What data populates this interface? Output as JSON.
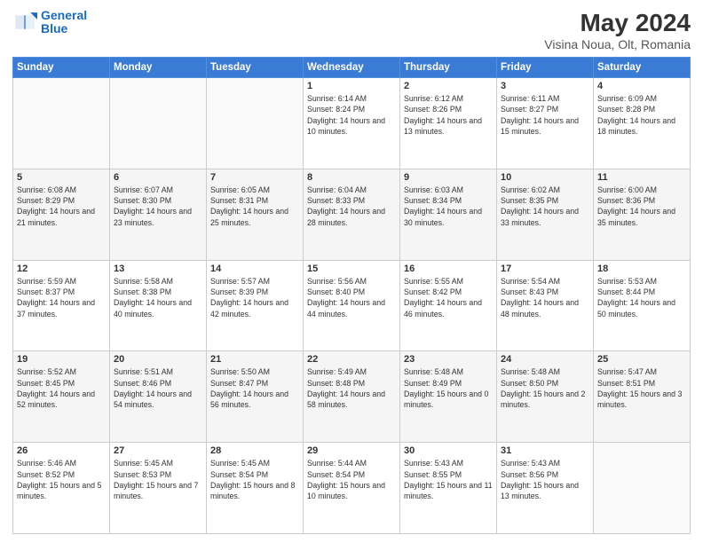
{
  "header": {
    "logo_line1": "General",
    "logo_line2": "Blue",
    "main_title": "May 2024",
    "sub_title": "Visina Noua, Olt, Romania"
  },
  "weekdays": [
    "Sunday",
    "Monday",
    "Tuesday",
    "Wednesday",
    "Thursday",
    "Friday",
    "Saturday"
  ],
  "weeks": [
    [
      {
        "day": "",
        "empty": true
      },
      {
        "day": "",
        "empty": true
      },
      {
        "day": "",
        "empty": true
      },
      {
        "day": "1",
        "sunrise": "6:14 AM",
        "sunset": "8:24 PM",
        "daylight": "14 hours and 10 minutes."
      },
      {
        "day": "2",
        "sunrise": "6:12 AM",
        "sunset": "8:26 PM",
        "daylight": "14 hours and 13 minutes."
      },
      {
        "day": "3",
        "sunrise": "6:11 AM",
        "sunset": "8:27 PM",
        "daylight": "14 hours and 15 minutes."
      },
      {
        "day": "4",
        "sunrise": "6:09 AM",
        "sunset": "8:28 PM",
        "daylight": "14 hours and 18 minutes."
      }
    ],
    [
      {
        "day": "5",
        "sunrise": "6:08 AM",
        "sunset": "8:29 PM",
        "daylight": "14 hours and 21 minutes."
      },
      {
        "day": "6",
        "sunrise": "6:07 AM",
        "sunset": "8:30 PM",
        "daylight": "14 hours and 23 minutes."
      },
      {
        "day": "7",
        "sunrise": "6:05 AM",
        "sunset": "8:31 PM",
        "daylight": "14 hours and 25 minutes."
      },
      {
        "day": "8",
        "sunrise": "6:04 AM",
        "sunset": "8:33 PM",
        "daylight": "14 hours and 28 minutes."
      },
      {
        "day": "9",
        "sunrise": "6:03 AM",
        "sunset": "8:34 PM",
        "daylight": "14 hours and 30 minutes."
      },
      {
        "day": "10",
        "sunrise": "6:02 AM",
        "sunset": "8:35 PM",
        "daylight": "14 hours and 33 minutes."
      },
      {
        "day": "11",
        "sunrise": "6:00 AM",
        "sunset": "8:36 PM",
        "daylight": "14 hours and 35 minutes."
      }
    ],
    [
      {
        "day": "12",
        "sunrise": "5:59 AM",
        "sunset": "8:37 PM",
        "daylight": "14 hours and 37 minutes."
      },
      {
        "day": "13",
        "sunrise": "5:58 AM",
        "sunset": "8:38 PM",
        "daylight": "14 hours and 40 minutes."
      },
      {
        "day": "14",
        "sunrise": "5:57 AM",
        "sunset": "8:39 PM",
        "daylight": "14 hours and 42 minutes."
      },
      {
        "day": "15",
        "sunrise": "5:56 AM",
        "sunset": "8:40 PM",
        "daylight": "14 hours and 44 minutes."
      },
      {
        "day": "16",
        "sunrise": "5:55 AM",
        "sunset": "8:42 PM",
        "daylight": "14 hours and 46 minutes."
      },
      {
        "day": "17",
        "sunrise": "5:54 AM",
        "sunset": "8:43 PM",
        "daylight": "14 hours and 48 minutes."
      },
      {
        "day": "18",
        "sunrise": "5:53 AM",
        "sunset": "8:44 PM",
        "daylight": "14 hours and 50 minutes."
      }
    ],
    [
      {
        "day": "19",
        "sunrise": "5:52 AM",
        "sunset": "8:45 PM",
        "daylight": "14 hours and 52 minutes."
      },
      {
        "day": "20",
        "sunrise": "5:51 AM",
        "sunset": "8:46 PM",
        "daylight": "14 hours and 54 minutes."
      },
      {
        "day": "21",
        "sunrise": "5:50 AM",
        "sunset": "8:47 PM",
        "daylight": "14 hours and 56 minutes."
      },
      {
        "day": "22",
        "sunrise": "5:49 AM",
        "sunset": "8:48 PM",
        "daylight": "14 hours and 58 minutes."
      },
      {
        "day": "23",
        "sunrise": "5:48 AM",
        "sunset": "8:49 PM",
        "daylight": "15 hours and 0 minutes."
      },
      {
        "day": "24",
        "sunrise": "5:48 AM",
        "sunset": "8:50 PM",
        "daylight": "15 hours and 2 minutes."
      },
      {
        "day": "25",
        "sunrise": "5:47 AM",
        "sunset": "8:51 PM",
        "daylight": "15 hours and 3 minutes."
      }
    ],
    [
      {
        "day": "26",
        "sunrise": "5:46 AM",
        "sunset": "8:52 PM",
        "daylight": "15 hours and 5 minutes."
      },
      {
        "day": "27",
        "sunrise": "5:45 AM",
        "sunset": "8:53 PM",
        "daylight": "15 hours and 7 minutes."
      },
      {
        "day": "28",
        "sunrise": "5:45 AM",
        "sunset": "8:54 PM",
        "daylight": "15 hours and 8 minutes."
      },
      {
        "day": "29",
        "sunrise": "5:44 AM",
        "sunset": "8:54 PM",
        "daylight": "15 hours and 10 minutes."
      },
      {
        "day": "30",
        "sunrise": "5:43 AM",
        "sunset": "8:55 PM",
        "daylight": "15 hours and 11 minutes."
      },
      {
        "day": "31",
        "sunrise": "5:43 AM",
        "sunset": "8:56 PM",
        "daylight": "15 hours and 13 minutes."
      },
      {
        "day": "",
        "empty": true
      }
    ]
  ],
  "labels": {
    "sunrise": "Sunrise:",
    "sunset": "Sunset:",
    "daylight": "Daylight:"
  }
}
